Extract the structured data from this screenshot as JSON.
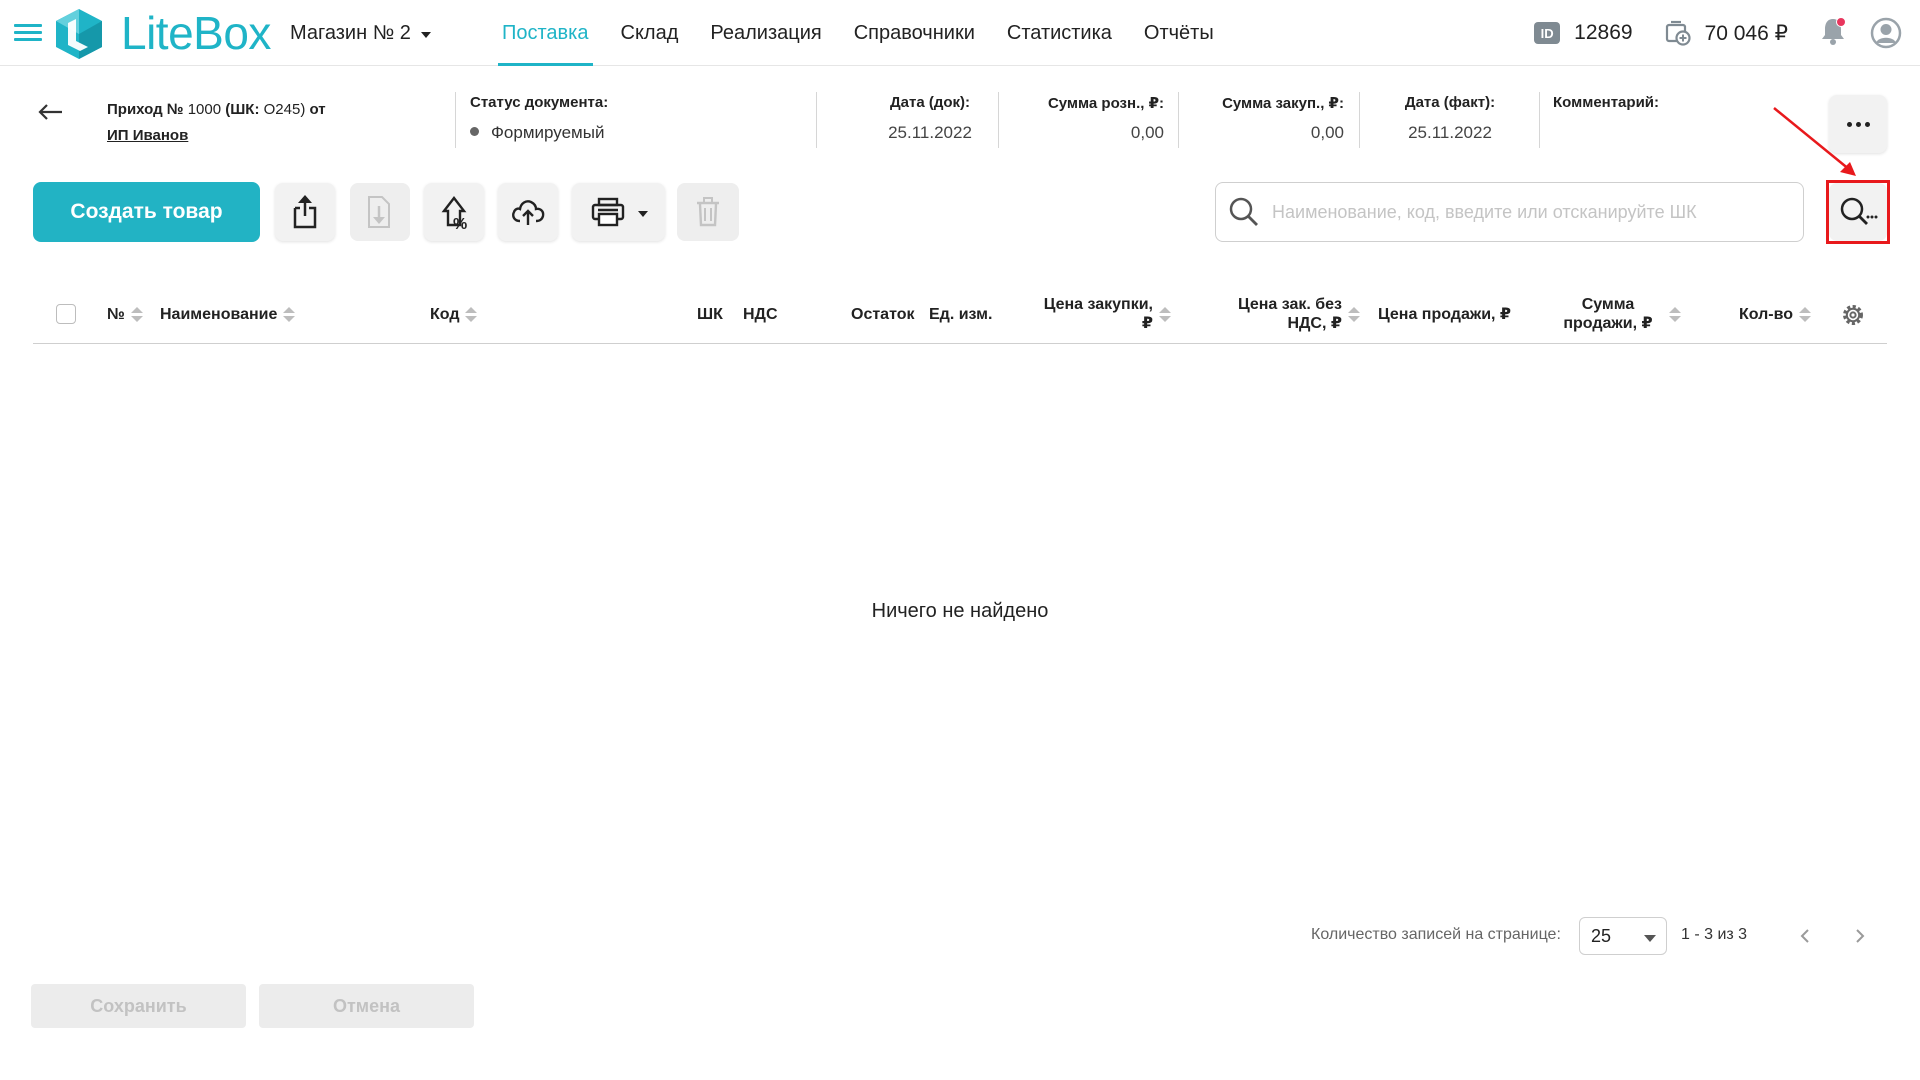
{
  "header": {
    "logo_text": "LiteBox",
    "store": "Магазин № 2",
    "nav": [
      {
        "label": "Поставка",
        "active": true
      },
      {
        "label": "Склад",
        "active": false
      },
      {
        "label": "Реализация",
        "active": false
      },
      {
        "label": "Справочники",
        "active": false
      },
      {
        "label": "Статистика",
        "active": false
      },
      {
        "label": "Отчёты",
        "active": false
      }
    ],
    "id_badge": "ID",
    "account_id": "12869",
    "balance": "70 046 ₽",
    "icons": [
      "menu-icon",
      "id-icon",
      "wallet-icon",
      "bell-icon",
      "user-avatar-icon"
    ],
    "accent_color": "#1fb4c7",
    "notification_color": "#e8365d"
  },
  "document": {
    "title_prefix": "Приход №",
    "number": "1000",
    "barcode_part": "(ШК:",
    "barcode": "O245)",
    "suffix": "от",
    "supplier": "ИП Иванов",
    "status_label": "Статус документа:",
    "status_value": "Формируемый",
    "date_doc_label": "Дата (док):",
    "date_doc": "25.11.2022",
    "retail_sum_label": "Сумма розн., ₽:",
    "retail_sum": "0,00",
    "purchase_sum_label": "Сумма закуп., ₽:",
    "purchase_sum": "0,00",
    "date_fact_label": "Дата (факт):",
    "date_fact": "25.11.2022",
    "comment_label": "Комментарий:",
    "comment": ""
  },
  "toolbar": {
    "create_label": "Создать товар",
    "icons": [
      "export-icon",
      "import-icon",
      "price-markup-icon",
      "upload-cloud-icon",
      "print-icon",
      "trash-icon"
    ],
    "search_placeholder": "Наименование, код, введите или отсканируйте ШК",
    "search_value": "",
    "highlight_color": "#e8191c"
  },
  "table": {
    "columns": [
      {
        "label": "№",
        "sortable": true
      },
      {
        "label": "Наименование",
        "sortable": true
      },
      {
        "label": "Код",
        "sortable": true
      },
      {
        "label": "ШК",
        "sortable": false
      },
      {
        "label": "НДС",
        "sortable": false
      },
      {
        "label": "Остаток",
        "sortable": false
      },
      {
        "label": "Ед. изм.",
        "sortable": false
      },
      {
        "label": "Цена закупки, ₽",
        "sortable": true
      },
      {
        "label": "Цена зак. без НДС, ₽",
        "sortable": true
      },
      {
        "label": "Цена продажи, ₽",
        "sortable": false
      },
      {
        "label": "Сумма продажи, ₽",
        "sortable": true
      },
      {
        "label": "Кол-во",
        "sortable": true
      }
    ],
    "rows": [],
    "empty_text": "Ничего не найдено"
  },
  "pagination": {
    "per_page_label": "Количество записей на странице:",
    "per_page": "25",
    "range": "1 - 3 из 3"
  },
  "footer": {
    "save_label": "Сохранить",
    "cancel_label": "Отмена"
  }
}
